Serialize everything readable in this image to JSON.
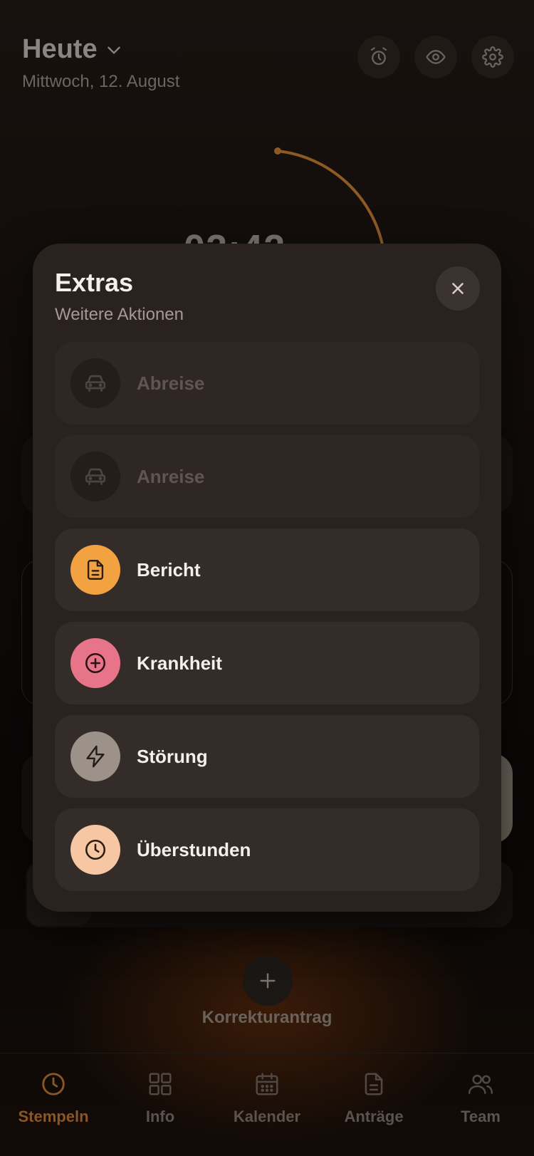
{
  "header": {
    "title": "Heute",
    "date": "Mittwoch, 12. August"
  },
  "background": {
    "clock_partial": "02:42",
    "korrektur_label": "Korrekturantrag"
  },
  "modal": {
    "title": "Extras",
    "subtitle": "Weitere Aktionen",
    "items": [
      {
        "label": "Abreise",
        "icon": "car-icon",
        "color": "#241e1b",
        "enabled": false
      },
      {
        "label": "Anreise",
        "icon": "car-icon",
        "color": "#241e1b",
        "enabled": false
      },
      {
        "label": "Bericht",
        "icon": "document-icon",
        "color": "#f2a240",
        "enabled": true
      },
      {
        "label": "Krankheit",
        "icon": "plus-circle-icon",
        "color": "#e8748a",
        "enabled": true
      },
      {
        "label": "Störung",
        "icon": "lightning-icon",
        "color": "#9d928a",
        "enabled": true
      },
      {
        "label": "Überstunden",
        "icon": "clock-icon",
        "color": "#f6c7a2",
        "enabled": true
      }
    ]
  },
  "nav": {
    "items": [
      {
        "label": "Stempeln",
        "icon": "clock-icon",
        "active": true
      },
      {
        "label": "Info",
        "icon": "grid-icon",
        "active": false
      },
      {
        "label": "Kalender",
        "icon": "calendar-icon",
        "active": false
      },
      {
        "label": "Anträge",
        "icon": "document-icon",
        "active": false
      },
      {
        "label": "Team",
        "icon": "people-icon",
        "active": false
      }
    ]
  },
  "colors": {
    "accent": "#8a5626",
    "modal_bg": "#29221f",
    "item_bg": "#332c28"
  }
}
